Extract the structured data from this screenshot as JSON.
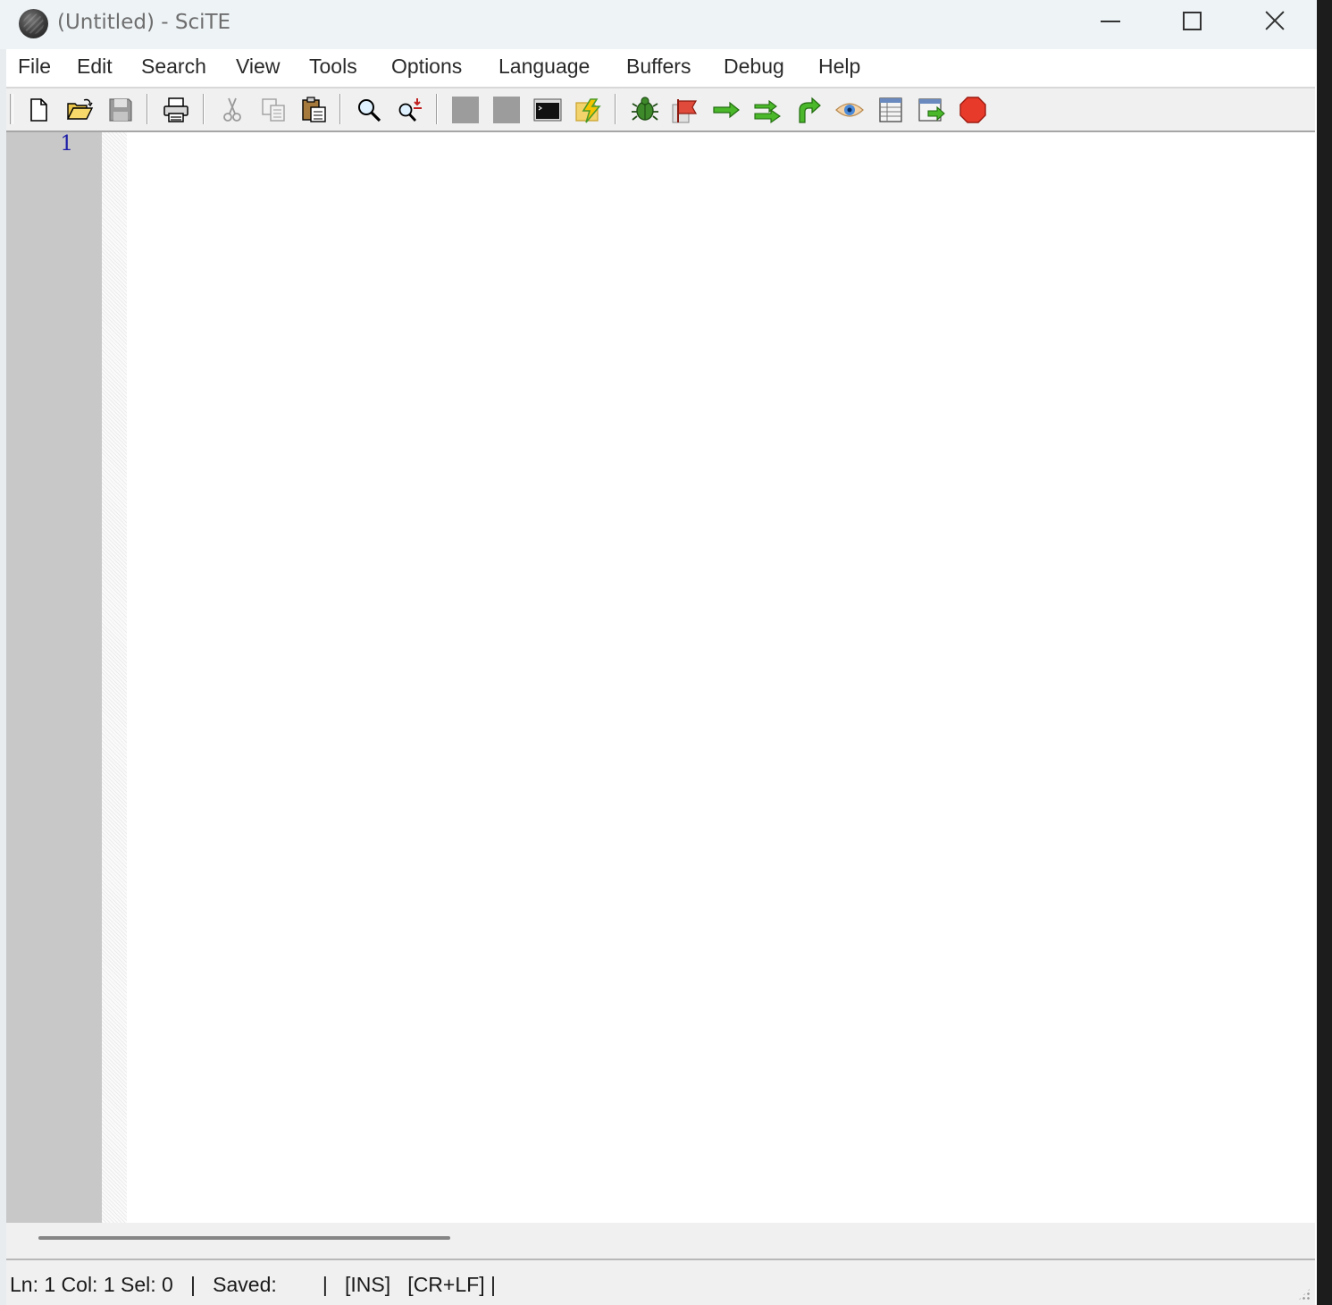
{
  "window": {
    "title": "(Untitled) - SciTE"
  },
  "menubar": {
    "items": [
      "File",
      "Edit",
      "Search",
      "View",
      "Tools",
      "Options",
      "Language",
      "Buffers",
      "Debug",
      "Help"
    ]
  },
  "toolbar": {
    "buttons": [
      "new-file-icon",
      "open-file-icon",
      "save-icon",
      "print-icon",
      "cut-icon",
      "copy-icon",
      "paste-icon",
      "find-icon",
      "find-replace-icon",
      "compile-icon",
      "build-icon",
      "terminal-icon",
      "go-icon",
      "debug-bug-icon",
      "breakpoint-flag-icon",
      "step-over-icon",
      "step-into-icon",
      "step-out-icon",
      "watch-eye-icon",
      "stack-table-icon",
      "run-to-cursor-icon",
      "stop-icon"
    ]
  },
  "editor": {
    "line_numbers": [
      "1"
    ],
    "content": ""
  },
  "statusbar": {
    "text": "Ln: 1 Col: 1 Sel: 0   |   Saved:        |   [INS]   [CR+LF] |"
  },
  "colors": {
    "line_number": "#1f1fa8",
    "margin": "#c8c8c8",
    "title_bar": "#eef3f6"
  }
}
